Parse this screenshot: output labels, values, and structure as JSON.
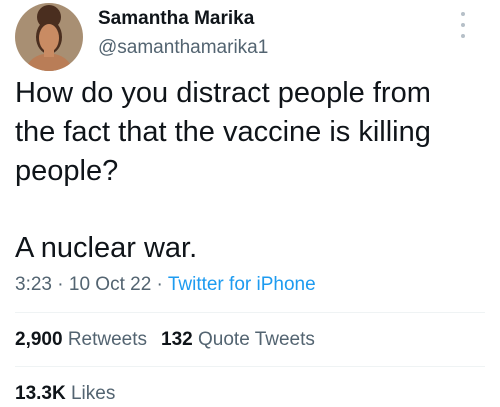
{
  "author": {
    "display_name": "Samantha Marika",
    "handle": "@samanthamarika1",
    "avatar_icon": "profile-photo",
    "more_icon": "more-vertical-icon"
  },
  "tweet": {
    "lines": [
      "How do you distract people from",
      "the fact that the vaccine is killing",
      "people?"
    ],
    "closing_line": "A nuclear war."
  },
  "meta": {
    "time": "3:23",
    "separator_1": " · ",
    "date": "10 Oct 22",
    "separator_2": " · ",
    "source": "Twitter for iPhone"
  },
  "stats": {
    "retweets_count": "2,900",
    "retweets_label": "Retweets",
    "quotes_count": "132",
    "quotes_label": "Quote Tweets",
    "likes_count": "13.3K",
    "likes_label": "Likes"
  },
  "colors": {
    "text": "#0f1419",
    "secondary": "#536471",
    "link": "#1d9bf0",
    "divider": "#eff3f4"
  }
}
